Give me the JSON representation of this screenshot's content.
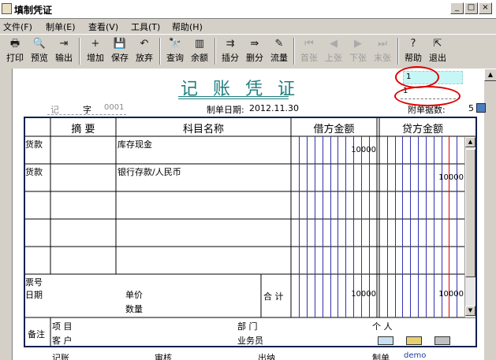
{
  "window": {
    "title": "填制凭证",
    "min": "_",
    "max": "□",
    "close": "×"
  },
  "menu": [
    "文件(F)",
    "制单(E)",
    "查看(V)",
    "工具(T)",
    "帮助(H)"
  ],
  "toolbar": [
    {
      "label": "打印",
      "icon": "🖶",
      "name": "print",
      "enabled": true
    },
    {
      "label": "预览",
      "icon": "🔍",
      "name": "preview",
      "enabled": true
    },
    {
      "label": "输出",
      "icon": "⇥",
      "name": "export",
      "enabled": true
    },
    {
      "label": "增加",
      "icon": "+",
      "name": "add",
      "enabled": true
    },
    {
      "label": "保存",
      "icon": "💾",
      "name": "save",
      "enabled": true
    },
    {
      "label": "放弃",
      "icon": "↶",
      "name": "discard",
      "enabled": true
    },
    {
      "label": "查询",
      "icon": "🔭",
      "name": "query",
      "enabled": true
    },
    {
      "label": "余额",
      "icon": "▥",
      "name": "balance",
      "enabled": true
    },
    {
      "label": "插分",
      "icon": "⇉",
      "name": "insert-entry",
      "enabled": true
    },
    {
      "label": "删分",
      "icon": "⇛",
      "name": "delete-entry",
      "enabled": true
    },
    {
      "label": "流量",
      "icon": "✎",
      "name": "cashflow",
      "enabled": true
    },
    {
      "label": "首张",
      "icon": "⏮",
      "name": "first",
      "enabled": false
    },
    {
      "label": "上张",
      "icon": "◀",
      "name": "prev",
      "enabled": false
    },
    {
      "label": "下张",
      "icon": "▶",
      "name": "next",
      "enabled": false
    },
    {
      "label": "末张",
      "icon": "⏭",
      "name": "last",
      "enabled": false
    },
    {
      "label": "帮助",
      "icon": "?",
      "name": "help",
      "enabled": true
    },
    {
      "label": "退出",
      "icon": "⇱",
      "name": "exit",
      "enabled": true
    }
  ],
  "voucher": {
    "title": "记 账 凭 证",
    "field_top": "1",
    "attach_value": "1",
    "type_label": "记",
    "zi_label": "字",
    "number": "0001",
    "date_label": "制单日期:",
    "date": "2012.11.30",
    "attach_label": "附单据数:",
    "attach_count": "5"
  },
  "headers": {
    "summary": "摘 要",
    "account": "科目名称",
    "debit": "借方金额",
    "credit": "贷方金额"
  },
  "rows": [
    {
      "summary": "货款",
      "account": "库存现金",
      "debit": "10000",
      "credit": ""
    },
    {
      "summary": "货款",
      "account": "银行存款/人民币",
      "debit": "",
      "credit": "10000"
    },
    {
      "summary": "",
      "account": "",
      "debit": "",
      "credit": ""
    },
    {
      "summary": "",
      "account": "",
      "debit": "",
      "credit": ""
    },
    {
      "summary": "",
      "account": "",
      "debit": "",
      "credit": ""
    }
  ],
  "footer": {
    "ticket": "票号",
    "date": "日期",
    "unit_price": "单价",
    "quantity": "数量",
    "total_label": "合 计",
    "total_debit": "10000",
    "total_credit": "10000",
    "remark": "备注",
    "item": "项 目",
    "customer": "客 户",
    "dept": "部 门",
    "salesman": "业务员",
    "person": "个 人"
  },
  "signatures": {
    "bookkeeping": "记账",
    "review": "审核",
    "cashier": "出纳",
    "maker_label": "制单",
    "maker": "demo"
  },
  "colors": {
    "title_teal": "#1f7f7f",
    "table_border": "#102050",
    "debit_red_line": "#e00000",
    "digit_blue_line": "#3030b0",
    "cyan_field": "#c6f6f6",
    "annotation_red": "#e00000"
  }
}
